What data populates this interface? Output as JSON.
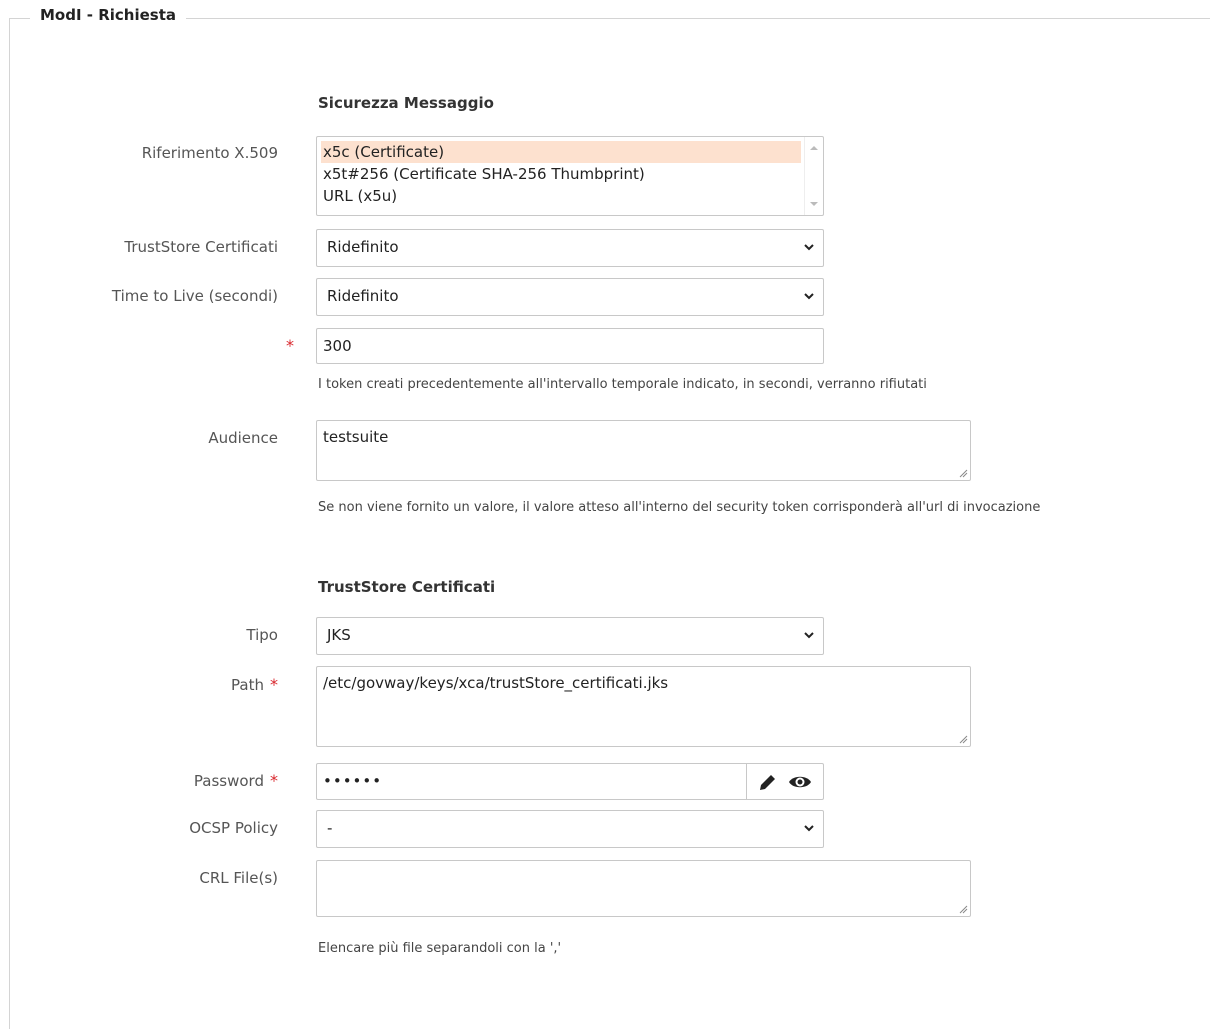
{
  "fieldset": {
    "legend": "ModI - Richiesta"
  },
  "sicurezza": {
    "title": "Sicurezza Messaggio",
    "riferimento": {
      "label": "Riferimento X.509",
      "options": [
        "x5c (Certificate)",
        "x5t#256 (Certificate SHA-256 Thumbprint)",
        "URL (x5u)"
      ],
      "selected": "x5c (Certificate)"
    },
    "truststore": {
      "label": "TrustStore Certificati",
      "value": "Ridefinito"
    },
    "ttl": {
      "label": "Time to Live (secondi)",
      "value": "Ridefinito"
    },
    "ttl_value": {
      "required_mark": "*",
      "value": "300",
      "hint": "I token creati precedentemente all'intervallo temporale indicato, in secondi, verranno rifiutati"
    },
    "audience": {
      "label": "Audience",
      "value": "testsuite",
      "hint": "Se non viene fornito un valore, il valore atteso all'interno del security token corrisponderà all'url di invocazione"
    }
  },
  "truststore_section": {
    "title": "TrustStore Certificati",
    "tipo": {
      "label": "Tipo",
      "value": "JKS"
    },
    "path": {
      "label": "Path",
      "required_mark": "*",
      "value": "/etc/govway/keys/xca/trustStore_certificati.jks"
    },
    "password": {
      "label": "Password",
      "required_mark": "*",
      "value": "••••••",
      "edit_icon": "pencil-icon",
      "show_icon": "eye-icon"
    },
    "ocsp": {
      "label": "OCSP Policy",
      "value": "-"
    },
    "crl": {
      "label": "CRL File(s)",
      "value": "",
      "hint": "Elencare più file separandoli con la ','"
    }
  },
  "colors": {
    "required": "#d9262c",
    "selected_option": "#fde1cf",
    "border": "#c8c8c8"
  }
}
